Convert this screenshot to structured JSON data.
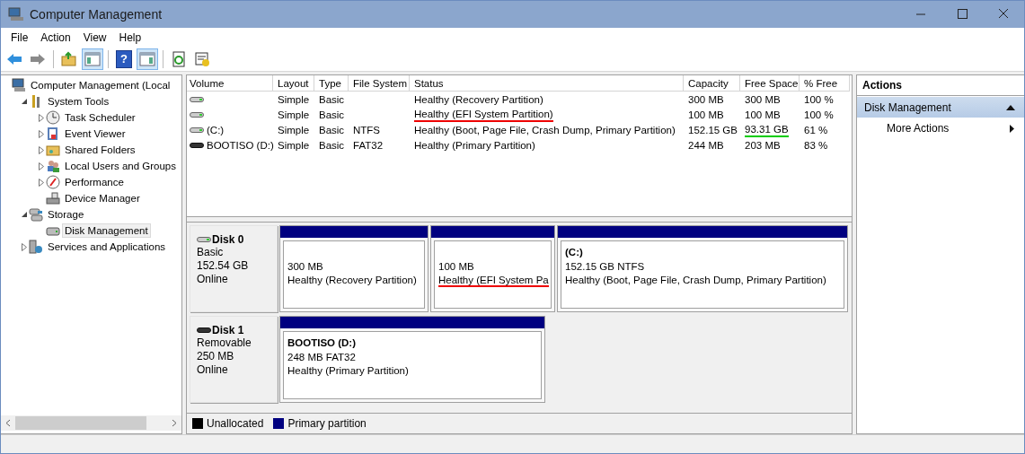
{
  "window": {
    "title": "Computer Management"
  },
  "menu": [
    "File",
    "Action",
    "View",
    "Help"
  ],
  "toolbar": [
    {
      "kind": "back",
      "pressed": false
    },
    {
      "kind": "forward",
      "pressed": false
    },
    {
      "kind": "up",
      "pressed": false
    },
    {
      "kind": "tree-pane",
      "pressed": true
    },
    {
      "kind": "help",
      "pressed": false,
      "label": "?"
    },
    {
      "kind": "action-pane",
      "pressed": true
    },
    {
      "kind": "refresh",
      "pressed": false
    },
    {
      "kind": "export",
      "pressed": false
    }
  ],
  "tree": [
    {
      "label": "Computer Management (Local",
      "kind": "computer",
      "selected": false,
      "children": [
        {
          "label": "System Tools",
          "kind": "tools",
          "selected": false,
          "expanded": true,
          "children": [
            {
              "label": "Task Scheduler",
              "kind": "clock",
              "selected": false,
              "expanded": false
            },
            {
              "label": "Event Viewer",
              "kind": "log",
              "selected": false,
              "expanded": false
            },
            {
              "label": "Shared Folders",
              "kind": "folder",
              "selected": false,
              "expanded": false
            },
            {
              "label": "Local Users and Groups",
              "kind": "users",
              "selected": false,
              "expanded": false
            },
            {
              "label": "Performance",
              "kind": "gauge",
              "selected": false,
              "expanded": false
            },
            {
              "label": "Device Manager",
              "kind": "devices",
              "selected": false
            }
          ]
        },
        {
          "label": "Storage",
          "kind": "storage",
          "selected": false,
          "expanded": true,
          "children": [
            {
              "label": "Disk Management",
              "kind": "disk",
              "selected": true
            }
          ]
        },
        {
          "label": "Services and Applications",
          "kind": "services",
          "selected": false,
          "expanded": false
        }
      ]
    }
  ],
  "table": {
    "columns": [
      "Volume",
      "Layout",
      "Type",
      "File System",
      "Status",
      "Capacity",
      "Free Space",
      "% Free"
    ],
    "rows": [
      {
        "kind": "fixed",
        "layout": "Simple",
        "type": "Basic",
        "status": "Healthy (Recovery Partition)",
        "capacity": "300 MB",
        "free_space": "300 MB",
        "pct_free": "100 %"
      },
      {
        "kind": "fixed",
        "layout": "Simple",
        "type": "Basic",
        "status": "Healthy (EFI System Partition)",
        "status_underline": {
          "color": "#ee0000"
        },
        "capacity": "100 MB",
        "free_space": "100 MB",
        "pct_free": "100 %"
      },
      {
        "kind": "fixed",
        "volume": "(C:)",
        "layout": "Simple",
        "type": "Basic",
        "file_system": "NTFS",
        "status": "Healthy (Boot, Page File, Crash Dump, Primary Partition)",
        "capacity": "152.15 GB",
        "free_space": "93.31 GB",
        "free_space_underline": {
          "color": "#00cc00"
        },
        "pct_free": "61 %"
      },
      {
        "kind": "removable",
        "volume": "BOOTISO (D:)",
        "layout": "Simple",
        "type": "Basic",
        "file_system": "FAT32",
        "status": "Healthy (Primary Partition)",
        "capacity": "244 MB",
        "free_space": "203 MB",
        "pct_free": "83 %"
      }
    ]
  },
  "disks": [
    {
      "name": "Disk 0",
      "kind": "fixed",
      "type": "Basic",
      "size": "152.54 GB",
      "status": "Online",
      "partitions": [
        {
          "kind": "primary",
          "size": "300 MB",
          "status": "Healthy (Recovery Partition)"
        },
        {
          "kind": "primary",
          "size": "100 MB",
          "status": "Healthy (EFI System Pa",
          "underline": {
            "color": "#ee0000"
          }
        },
        {
          "kind": "primary",
          "label": "(C:)",
          "size": "152.15 GB NTFS",
          "status": "Healthy (Boot, Page File, Crash Dump, Primary Partition)"
        }
      ]
    },
    {
      "name": "Disk 1",
      "kind": "removable",
      "type": "Removable",
      "size": "250 MB",
      "status": "Online",
      "partitions": [
        {
          "kind": "primary",
          "label": "BOOTISO  (D:)",
          "size": "248 MB FAT32",
          "status": "Healthy (Primary Partition)"
        }
      ]
    }
  ],
  "legend": [
    {
      "kind": "unallocated",
      "label": "Unallocated",
      "color": "#000000"
    },
    {
      "kind": "primary",
      "label": "Primary partition",
      "color": "#000080"
    }
  ],
  "actions": {
    "title": "Actions",
    "sections": [
      {
        "label": "Disk Management",
        "expanded": true,
        "items": [
          "More Actions"
        ]
      }
    ]
  }
}
